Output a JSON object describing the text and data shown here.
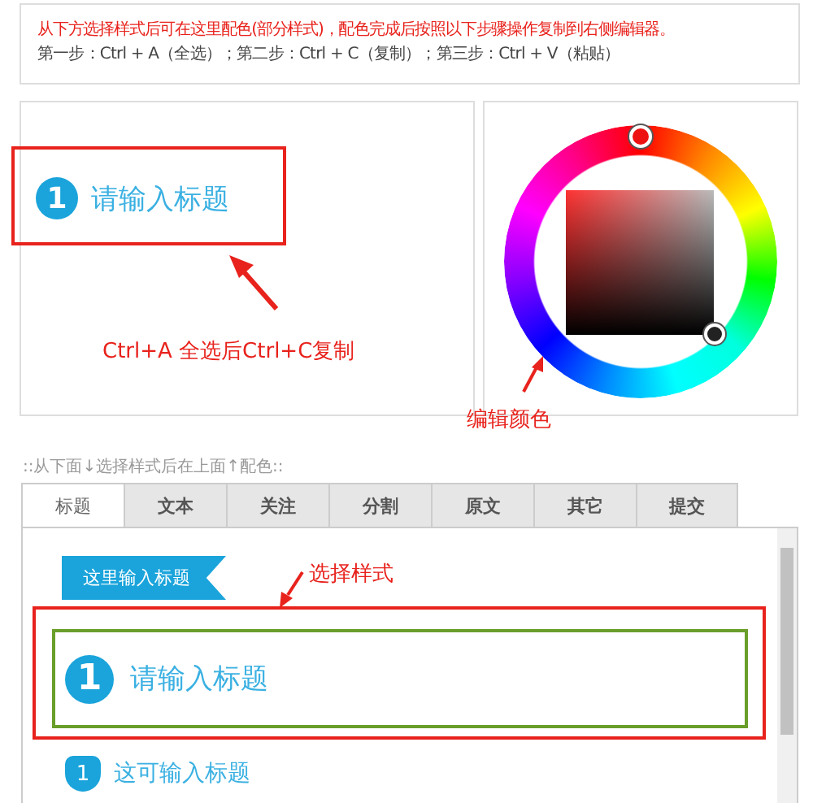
{
  "instructions": {
    "note": "从下方选择样式后可在这里配色(部分样式)，配色完成后按照以下步骤操作复制到右侧编辑器。",
    "steps": "第一步：Ctrl + A（全选）；第二步：Ctrl + C（复制）；第三步：Ctrl + V（粘贴）"
  },
  "preview": {
    "number": "1",
    "title": "请输入标题"
  },
  "annotations": [
    {
      "kind": "copy",
      "text": "Ctrl+A 全选后Ctrl+C复制"
    },
    {
      "kind": "color",
      "text": "编辑颜色"
    },
    {
      "kind": "style",
      "text": "选择样式"
    }
  ],
  "style_hint": "::从下面↓选择样式后在上面↑配色::",
  "tabs": [
    {
      "label": "标题",
      "selected": true
    },
    {
      "label": "文本",
      "selected": false
    },
    {
      "label": "关注",
      "selected": false
    },
    {
      "label": "分割",
      "selected": false
    },
    {
      "label": "原文",
      "selected": false
    },
    {
      "label": "其它",
      "selected": false
    },
    {
      "label": "提交",
      "selected": false
    }
  ],
  "styles": [
    {
      "kind": "flag",
      "title": "这里输入标题",
      "selected": false
    },
    {
      "kind": "circle",
      "number": "1",
      "title": "请输入标题",
      "selected": true
    },
    {
      "kind": "badge",
      "number": "1",
      "title": "这可输入标题",
      "selected": false
    }
  ]
}
